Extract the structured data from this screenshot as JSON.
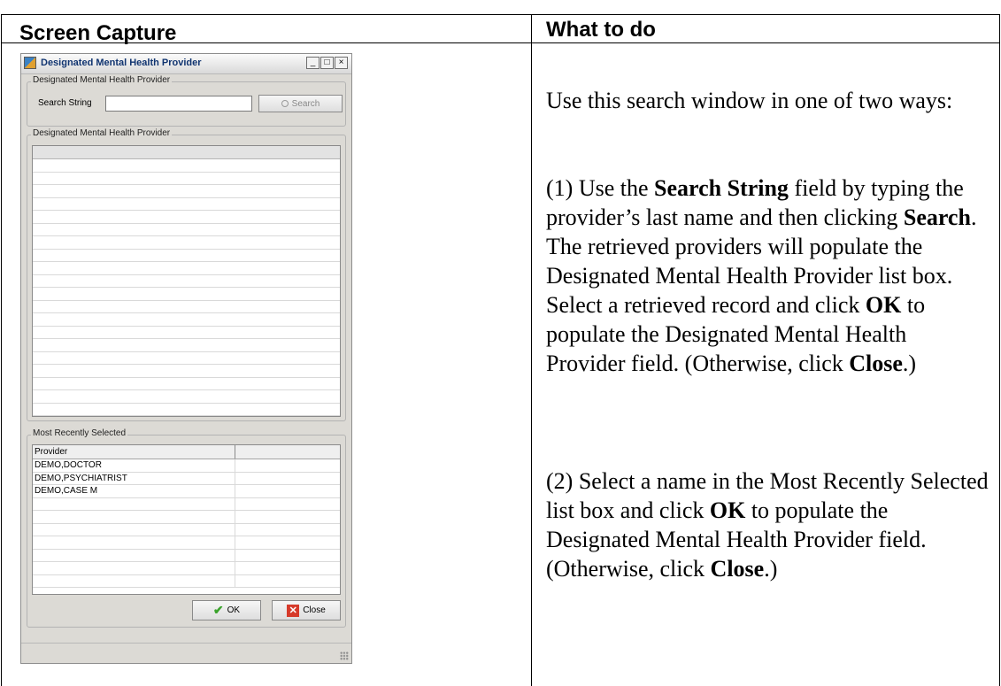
{
  "table": {
    "col1_header": "Screen Capture",
    "col2_header": "What to do"
  },
  "dialog": {
    "title": "Designated Mental Health Provider",
    "window_buttons": [
      "_",
      "□",
      "×"
    ],
    "search_group": {
      "label": "Designated Mental Health Provider",
      "search_label": "Search String",
      "search_value": "",
      "search_button": "Search"
    },
    "results_group": {
      "label": "Designated Mental Health Provider"
    },
    "recent_group": {
      "label": "Most Recently Selected",
      "column_header": "Provider",
      "rows": [
        "DEMO,DOCTOR",
        "DEMO,PSYCHIATRIST",
        "DEMO,CASE M"
      ]
    },
    "ok_button": "OK",
    "close_button": "Close"
  },
  "instructions": {
    "intro": "Use this search window in one of two ways:",
    "p1": [
      {
        "t": "(1) Use the ",
        "b": false
      },
      {
        "t": "Search String",
        "b": true
      },
      {
        "t": " field by typing the provider’s last name and then clicking ",
        "b": false
      },
      {
        "t": "Search",
        "b": true
      },
      {
        "t": ". The retrieved providers will populate the Designated Mental Health Provider list box. Select a retrieved record and click ",
        "b": false
      },
      {
        "t": "OK",
        "b": true
      },
      {
        "t": " to populate the Designated Mental Health Provider field. (Otherwise, click ",
        "b": false
      },
      {
        "t": "Close",
        "b": true
      },
      {
        "t": ".)",
        "b": false
      }
    ],
    "p2": [
      {
        "t": "(2) Select a name in the Most Recently Selected list box and click ",
        "b": false
      },
      {
        "t": "OK",
        "b": true
      },
      {
        "t": " to populate the Designated Mental Health Provider field. (Otherwise, click ",
        "b": false
      },
      {
        "t": "Close",
        "b": true
      },
      {
        "t": ".)",
        "b": false
      }
    ]
  }
}
